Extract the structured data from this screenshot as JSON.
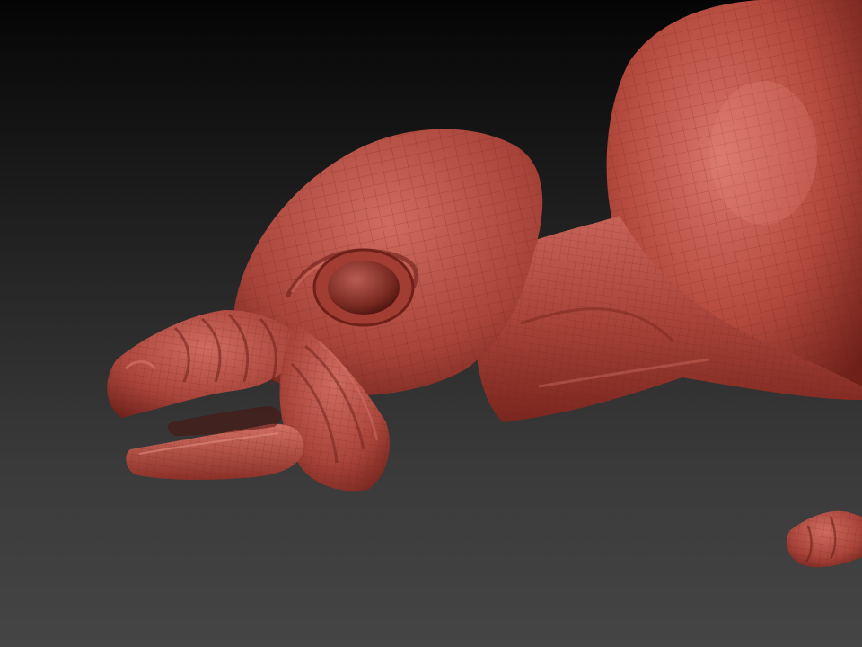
{
  "viewport": {
    "background_top": "#050505",
    "background_bottom": "#454545"
  },
  "model": {
    "material_base": "#b44a3e",
    "material_light": "#d9766a",
    "material_dark": "#6e2019",
    "wireframe_color": "#5e1d16"
  }
}
